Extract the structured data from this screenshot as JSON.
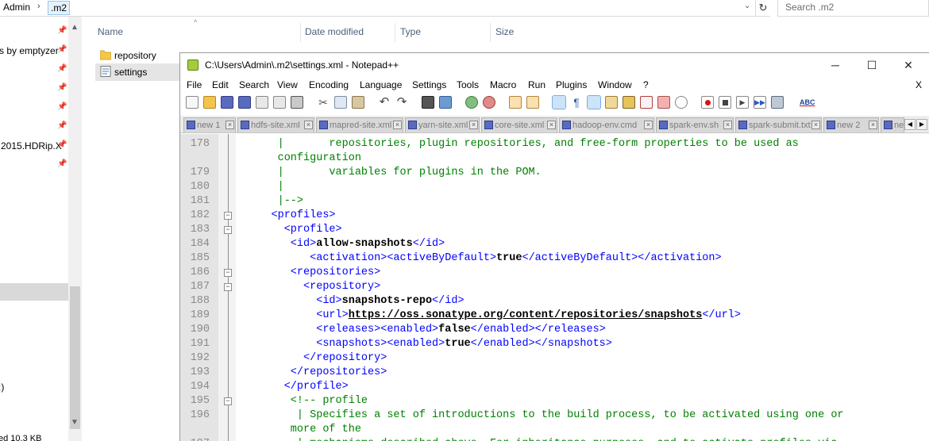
{
  "explorer": {
    "breadcrumb": [
      "Admin",
      ".m2"
    ],
    "search_placeholder": "Search .m2",
    "columns": [
      "Name",
      "Date modified",
      "Type",
      "Size"
    ],
    "files": [
      {
        "name": "repository",
        "icon": "folder-icon"
      },
      {
        "name": "settings",
        "icon": "xml-file-icon"
      }
    ],
    "nav_items": [
      "s by emptyzer",
      "2015.HDRip.X",
      ":)",
      "ed 10.3 KB"
    ]
  },
  "notepad": {
    "title": "C:\\Users\\Admin\\.m2\\settings.xml - Notepad++",
    "window_buttons": {
      "minimize": "─",
      "maximize": "☐",
      "close": "✕"
    },
    "menu": [
      "File",
      "Edit",
      "Search",
      "View",
      "Encoding",
      "Language",
      "Settings",
      "Tools",
      "Macro",
      "Run",
      "Plugins",
      "Window",
      "?"
    ],
    "menu_close": "X",
    "tabs": [
      "new 1",
      "hdfs-site.xml",
      "mapred-site.xml",
      "yarn-site.xml",
      "core-site.xml",
      "hadoop-env.cmd",
      "spark-env.sh",
      "spark-submit.txt",
      "new 2",
      "ne"
    ],
    "lines": [
      {
        "n": "178",
        "segs": [
          {
            "c": "cm",
            "t": "      |       repositories, plugin repositories, and free-form properties to be used as"
          }
        ]
      },
      {
        "n": "",
        "segs": [
          {
            "c": "cm",
            "t": "      configuration"
          }
        ]
      },
      {
        "n": "179",
        "segs": [
          {
            "c": "cm",
            "t": "      |       variables for plugins in the POM."
          }
        ]
      },
      {
        "n": "180",
        "segs": [
          {
            "c": "cm",
            "t": "      |"
          }
        ]
      },
      {
        "n": "181",
        "segs": [
          {
            "c": "cm",
            "t": "      |-->"
          }
        ]
      },
      {
        "n": "182",
        "segs": [
          {
            "c": "tg",
            "t": "     <profiles>"
          }
        ]
      },
      {
        "n": "183",
        "segs": [
          {
            "c": "tg",
            "t": "       <profile>"
          }
        ]
      },
      {
        "n": "184",
        "segs": [
          {
            "c": "tg",
            "t": "        <id>"
          },
          {
            "c": "tx",
            "t": "allow-snapshots"
          },
          {
            "c": "tg",
            "t": "</id>"
          }
        ]
      },
      {
        "n": "185",
        "segs": [
          {
            "c": "tg",
            "t": "           <activation><activeByDefault>"
          },
          {
            "c": "tx",
            "t": "true"
          },
          {
            "c": "tg",
            "t": "</activeByDefault></activation>"
          }
        ]
      },
      {
        "n": "186",
        "segs": [
          {
            "c": "tg",
            "t": "        <repositories>"
          }
        ]
      },
      {
        "n": "187",
        "segs": [
          {
            "c": "tg",
            "t": "          <repository>"
          }
        ]
      },
      {
        "n": "188",
        "segs": [
          {
            "c": "tg",
            "t": "            <id>"
          },
          {
            "c": "tx",
            "t": "snapshots-repo"
          },
          {
            "c": "tg",
            "t": "</id>"
          }
        ]
      },
      {
        "n": "189",
        "segs": [
          {
            "c": "tg",
            "t": "            <url>"
          },
          {
            "c": "url",
            "t": "https://oss.sonatype.org/content/repositories/snapshots"
          },
          {
            "c": "tg",
            "t": "</url>"
          }
        ]
      },
      {
        "n": "190",
        "segs": [
          {
            "c": "tg",
            "t": "            <releases><enabled>"
          },
          {
            "c": "tx",
            "t": "false"
          },
          {
            "c": "tg",
            "t": "</enabled></releases>"
          }
        ]
      },
      {
        "n": "191",
        "segs": [
          {
            "c": "tg",
            "t": "            <snapshots><enabled>"
          },
          {
            "c": "tx",
            "t": "true"
          },
          {
            "c": "tg",
            "t": "</enabled></snapshots>"
          }
        ]
      },
      {
        "n": "192",
        "segs": [
          {
            "c": "tg",
            "t": "          </repository>"
          }
        ]
      },
      {
        "n": "193",
        "segs": [
          {
            "c": "tg",
            "t": "        </repositories>"
          }
        ]
      },
      {
        "n": "194",
        "segs": [
          {
            "c": "tg",
            "t": "       </profile>"
          }
        ]
      },
      {
        "n": "195",
        "segs": [
          {
            "c": "cm",
            "t": "        <!-- profile"
          }
        ]
      },
      {
        "n": "196",
        "segs": [
          {
            "c": "cm",
            "t": "         | Specifies a set of introductions to the build process, to be activated using one or"
          }
        ]
      },
      {
        "n": "",
        "segs": [
          {
            "c": "cm",
            "t": "        more of the"
          }
        ]
      },
      {
        "n": "197",
        "segs": [
          {
            "c": "cm",
            "t": "         | mechanisms described above. For inheritance purposes, and to activate profiles via"
          }
        ]
      }
    ]
  },
  "colors": {
    "comment": "#008000",
    "tag": "#0000ff",
    "text": "#000000",
    "gutter": "#e4e4e4"
  }
}
